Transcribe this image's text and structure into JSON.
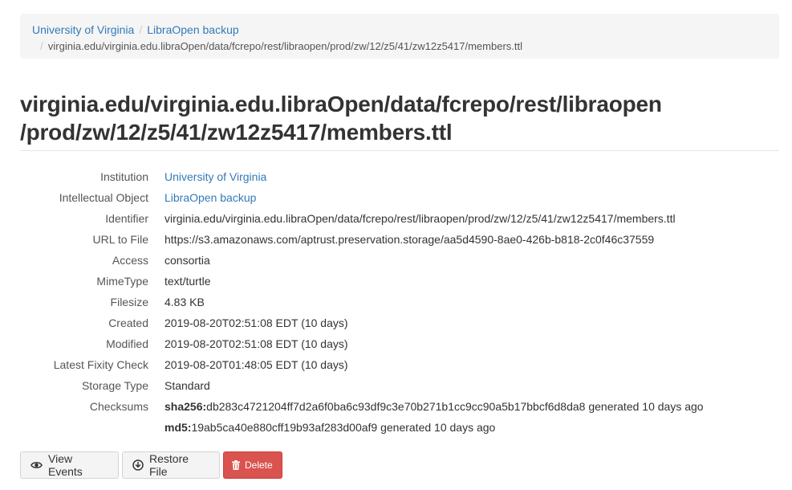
{
  "breadcrumb": {
    "institution": "University of Virginia",
    "object": "LibraOpen backup",
    "separator": "/",
    "current": "virginia.edu/virginia.edu.libraOpen/data/fcrepo/rest/libraopen/prod/zw/12/z5/41/zw12z5417/members.ttl"
  },
  "title": {
    "line1": "virginia.edu/virginia.edu.libraOpen/data/fcrepo/rest/libraopen",
    "line2": "/prod/zw/12/z5/41/zw12z5417/members.ttl"
  },
  "details": {
    "institution_label": "Institution",
    "institution_value": "University of Virginia",
    "object_label": "Intellectual Object",
    "object_value": "LibraOpen backup",
    "identifier_label": "Identifier",
    "identifier_value": "virginia.edu/virginia.edu.libraOpen/data/fcrepo/rest/libraopen/prod/zw/12/z5/41/zw12z5417/members.ttl",
    "url_label": "URL to File",
    "url_value": "https://s3.amazonaws.com/aptrust.preservation.storage/aa5d4590-8ae0-426b-b818-2c0f46c37559",
    "access_label": "Access",
    "access_value": "consortia",
    "mimetype_label": "MimeType",
    "mimetype_value": "text/turtle",
    "filesize_label": "Filesize",
    "filesize_value": "4.83 KB",
    "created_label": "Created",
    "created_value": "2019-08-20T02:51:08 EDT (10 days)",
    "modified_label": "Modified",
    "modified_value": "2019-08-20T02:51:08 EDT (10 days)",
    "fixity_label": "Latest Fixity Check",
    "fixity_value": "2019-08-20T01:48:05 EDT (10 days)",
    "storage_label": "Storage Type",
    "storage_value": "Standard",
    "checksums_label": "Checksums",
    "checksums": [
      {
        "algorithm": "sha256:",
        "digest": "db283c4721204ff7d2a6f0ba6c93df9c3e70b271b1cc9cc90a5b17bbcf6d8da8",
        "note": " generated 10 days ago"
      },
      {
        "algorithm": "md5:",
        "digest": "19ab5ca40e880cff19b93af283d00af9",
        "note": " generated 10 days ago"
      }
    ]
  },
  "buttons": {
    "view_events": "View Events",
    "restore_file": "Restore File",
    "delete": "Delete"
  },
  "icons": {
    "view_events": "eye-icon",
    "restore_file": "download-circle-icon",
    "delete": "trash-icon"
  },
  "colors": {
    "link": "#337ab7",
    "danger": "#d9534f",
    "breadcrumb_bg": "#f5f5f5"
  }
}
